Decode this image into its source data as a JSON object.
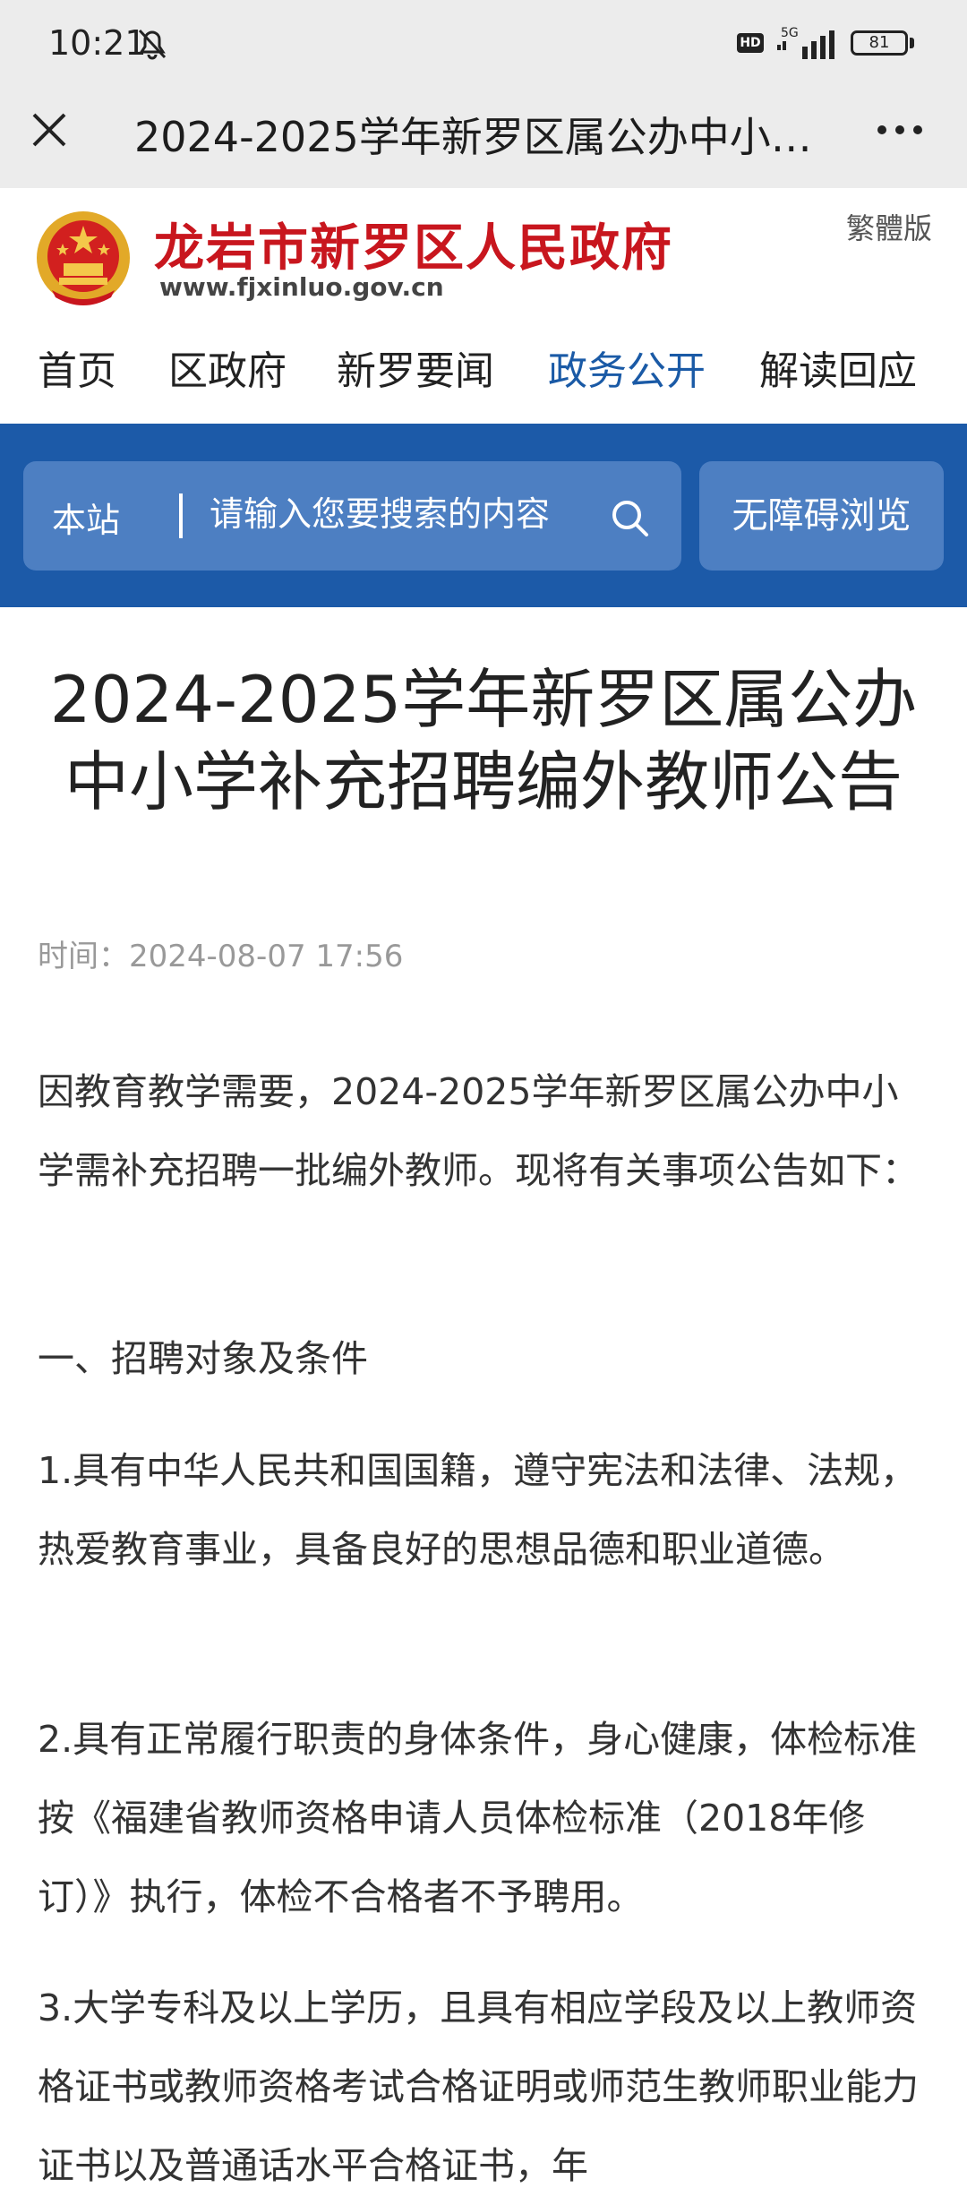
{
  "status_bar": {
    "time": "10:21",
    "network": "5G",
    "hd_label": "HD",
    "battery": "81"
  },
  "title_bar": {
    "title": "2024-2025学年新罗区属公办中小学补充招聘编外教师公告"
  },
  "header": {
    "site_name": "龙岩市新罗区人民政府",
    "site_url": "www.fjxinluo.gov.cn",
    "traditional_link": "繁體版",
    "nav": [
      "首页",
      "区政府",
      "新罗要闻",
      "政务公开",
      "解读回应"
    ],
    "active_nav": "政务公开"
  },
  "search": {
    "scope": "本站",
    "placeholder": "请输入您要搜索的内容",
    "accessibility_button": "无障碍浏览"
  },
  "article": {
    "title_line1": "2024-2025学年新罗区属公办",
    "title_line2": "中小学补充招聘编外教师公告",
    "time": "时间：2024-08-07 17:56",
    "paragraphs": [
      "因教育教学需要，2024-2025学年新罗区属公办中小学需补充招聘一批编外教师。现将有关事项公告如下：",
      "一、招聘对象及条件",
      "1.具有中华人民共和国国籍，遵守宪法和法律、法规，热爱教育事业，具备良好的思想品德和职业道德。",
      "2.具有正常履行职责的身体条件，身心健康，体检标准按《福建省教师资格申请人员体检标准（2018年修订）》执行，体检不合格者不予聘用。",
      "3.大学专科及以上学历，且具有相应学段及以上教师资格证书或教师资格考试合格证明或师范生教师职业能力证书以及普通话水平合格证书，年"
    ]
  },
  "colors": {
    "accent_blue": "#1c5aa8",
    "search_box": "#4d7fc2",
    "site_red": "#c8161e",
    "active_nav": "#1a5aa6"
  }
}
